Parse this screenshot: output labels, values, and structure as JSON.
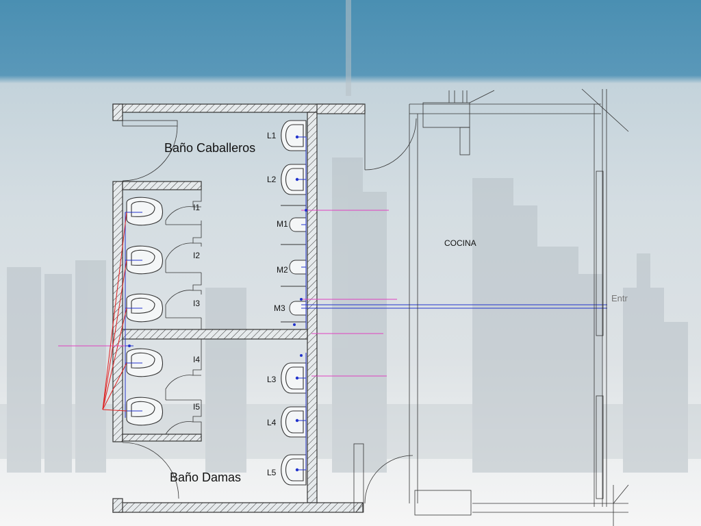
{
  "rooms": {
    "men": "Baño Caballeros",
    "women": "Baño Damas",
    "kitchen": "COCINA",
    "entrance_partial": "Entr"
  },
  "sinks_right": [
    "L1",
    "L2",
    "L3",
    "L4",
    "L5"
  ],
  "urinals": [
    "M1",
    "M2",
    "M3"
  ],
  "toilets": [
    "I1",
    "I2",
    "I3",
    "I4",
    "I5"
  ],
  "colors": {
    "banner": "#4a8fb2",
    "wall_line": "#333333",
    "pipe_blue": "#2233cc",
    "pipe_magenta": "#e040c0",
    "pipe_red": "#e02020"
  }
}
